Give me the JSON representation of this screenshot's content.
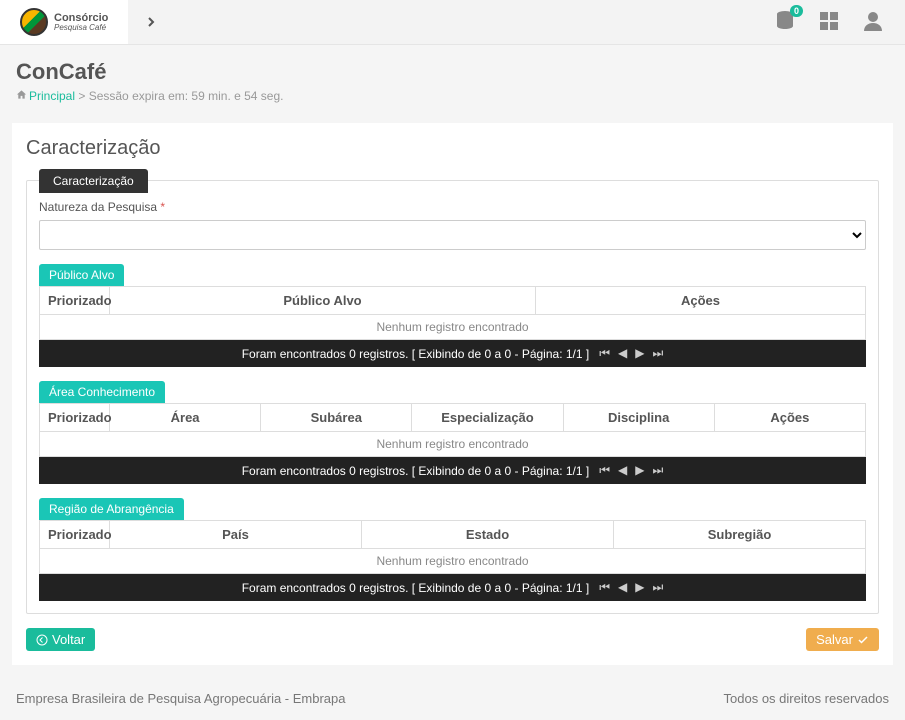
{
  "app": {
    "logo_title": "Consórcio",
    "logo_sub": "Pesquisa Café",
    "badge_count": "0"
  },
  "header": {
    "page_title": "ConCafé",
    "breadcrumb_link": "Principal",
    "breadcrumb_rest": " > Sessão expira em: 59 min. e 54 seg."
  },
  "panel": {
    "title": "Caracterização",
    "tab_label": "Caracterização",
    "natureza_label": "Natureza da Pesquisa",
    "required_mark": "*"
  },
  "sections": {
    "publico": {
      "tag": "Público Alvo",
      "cols": [
        "Priorizado",
        "Público Alvo",
        "Ações"
      ],
      "empty": "Nenhum registro encontrado",
      "pager": "Foram encontrados 0 registros. [ Exibindo de 0 a 0 - Página: 1/1 ]"
    },
    "area": {
      "tag": "Área Conhecimento",
      "cols": [
        "Priorizado",
        "Área",
        "Subárea",
        "Especialização",
        "Disciplina",
        "Ações"
      ],
      "empty": "Nenhum registro encontrado",
      "pager": "Foram encontrados 0 registros. [ Exibindo de 0 a 0 - Página: 1/1 ]"
    },
    "regiao": {
      "tag": "Região de Abrangência",
      "cols": [
        "Priorizado",
        "País",
        "Estado",
        "Subregião"
      ],
      "empty": "Nenhum registro encontrado",
      "pager": "Foram encontrados 0 registros. [ Exibindo de 0 a 0 - Página: 1/1 ]"
    }
  },
  "buttons": {
    "voltar": "Voltar",
    "salvar": "Salvar"
  },
  "footer": {
    "left": "Empresa Brasileira de Pesquisa Agropecuária - Embrapa",
    "right": "Todos os direitos reservados"
  }
}
